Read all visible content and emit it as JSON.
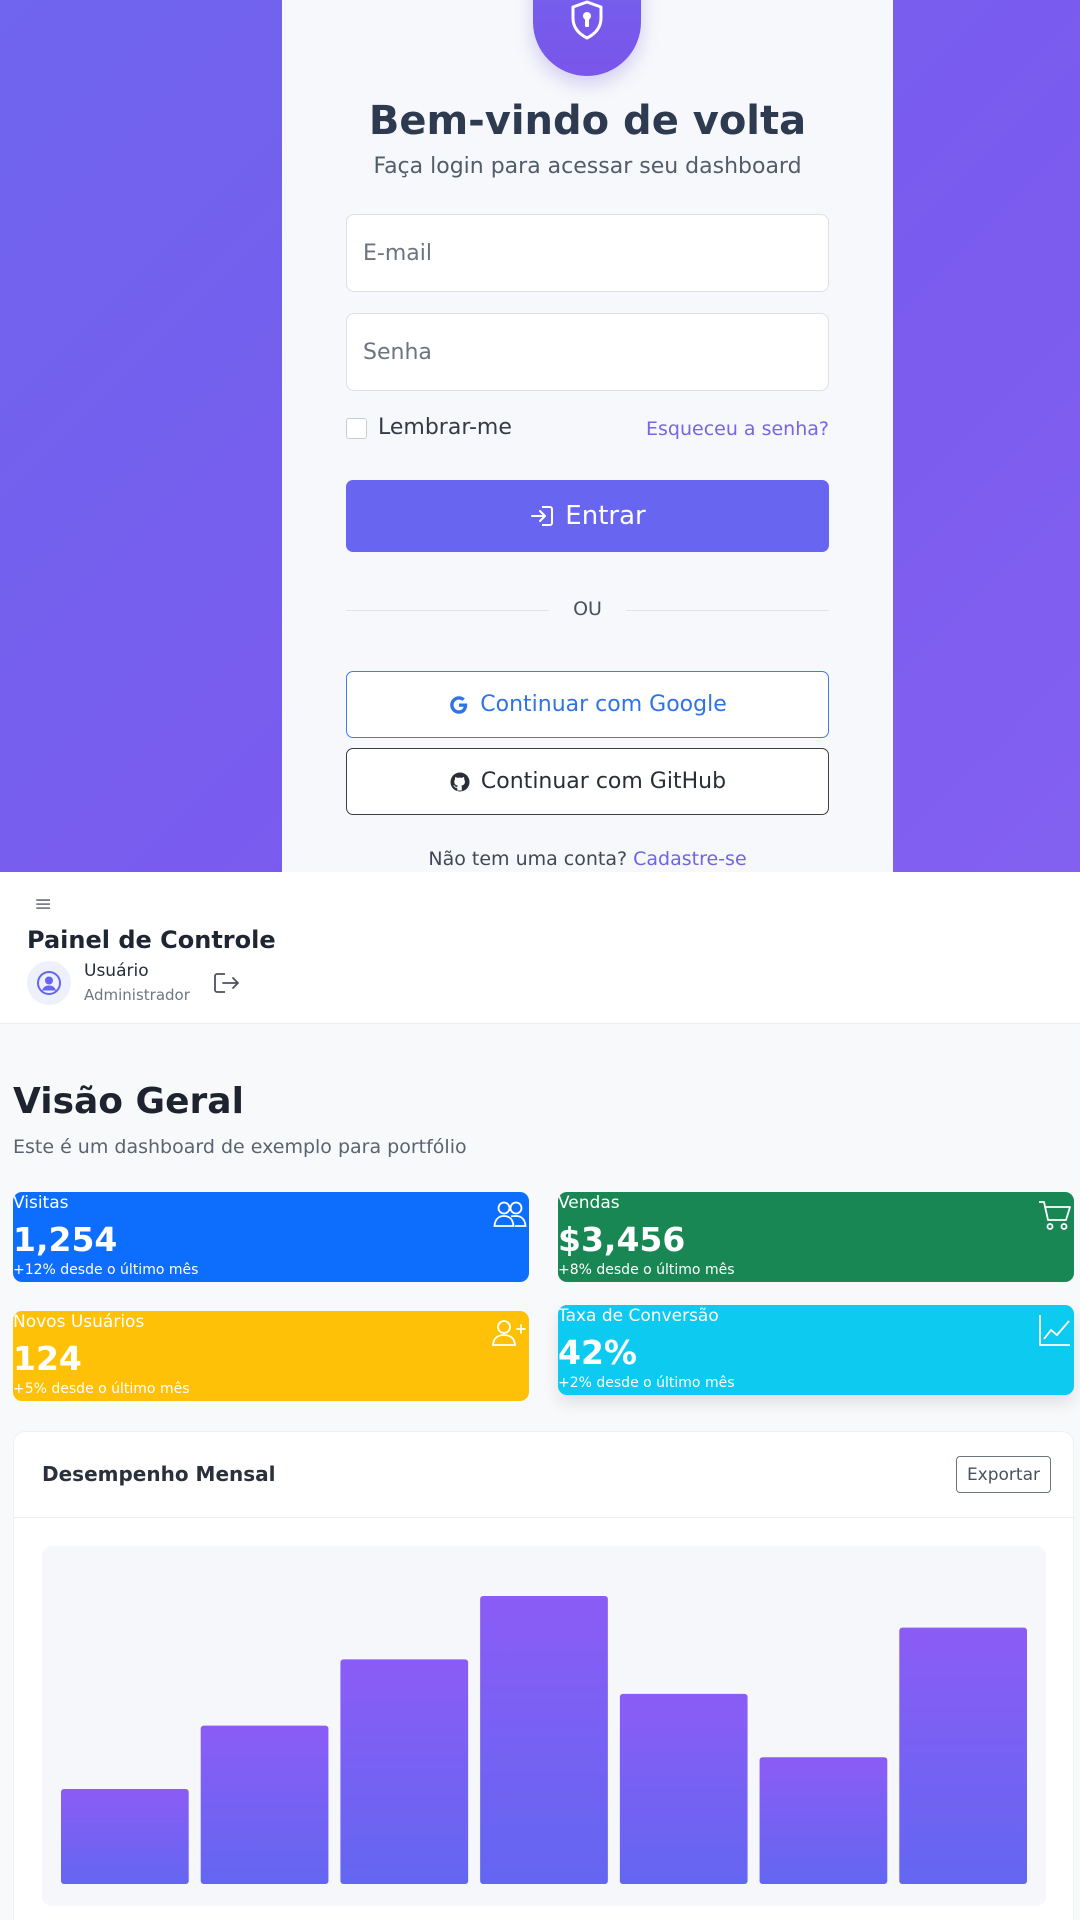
{
  "login": {
    "title": "Bem-vindo de volta",
    "subtitle": "Faça login para acessar seu dashboard",
    "email_placeholder": "E-mail",
    "password_placeholder": "Senha",
    "remember_label": "Lembrar-me",
    "forgot_link": "Esqueceu a senha?",
    "submit_label": "Entrar",
    "divider_text": "OU",
    "google_label": "Continuar com Google",
    "github_label": "Continuar com GitHub",
    "signup_prompt": "Não tem uma conta?",
    "signup_link": "Cadastre-se",
    "logo_icon": "shield-lock-icon",
    "accent_color": "#6866f0"
  },
  "header": {
    "menu_icon": "≡",
    "title": "Painel de Controle",
    "user_name": "Usuário",
    "user_role": "Administrador",
    "avatar_icon": "user-circle-icon",
    "logout_icon": "logout-icon"
  },
  "main": {
    "title": "Visão Geral",
    "subtitle": "Este é um dashboard de exemplo para portfólio",
    "stats": [
      {
        "label": "Visitas",
        "value": "1,254",
        "change": "+12% desde o último mês",
        "icon": "people-icon",
        "color": "#0d6efd"
      },
      {
        "label": "Vendas",
        "value": "$3,456",
        "change": "+8% desde o último mês",
        "icon": "cart-icon",
        "color": "#198754"
      },
      {
        "label": "Novos Usuários",
        "value": "124",
        "change": "+5% desde o último mês",
        "icon": "person-add-icon",
        "color": "#ffc107"
      },
      {
        "label": "Taxa de Conversão",
        "value": "42%",
        "change": "+2% desde o último mês",
        "icon": "trend-chart-icon",
        "color": "#0dcaf0"
      }
    ],
    "chart_card": {
      "title": "Desempenho Mensal",
      "export_label": "Exportar"
    }
  },
  "chart_data": {
    "type": "bar",
    "title": "Desempenho Mensal",
    "xlabel": "",
    "ylabel": "",
    "categories": [],
    "values": [
      33,
      55,
      78,
      100,
      66,
      44,
      89
    ],
    "ylim": [
      0,
      100
    ],
    "grid": false,
    "bar_gradient": [
      "#8b5cf6",
      "#6366f1"
    ]
  }
}
